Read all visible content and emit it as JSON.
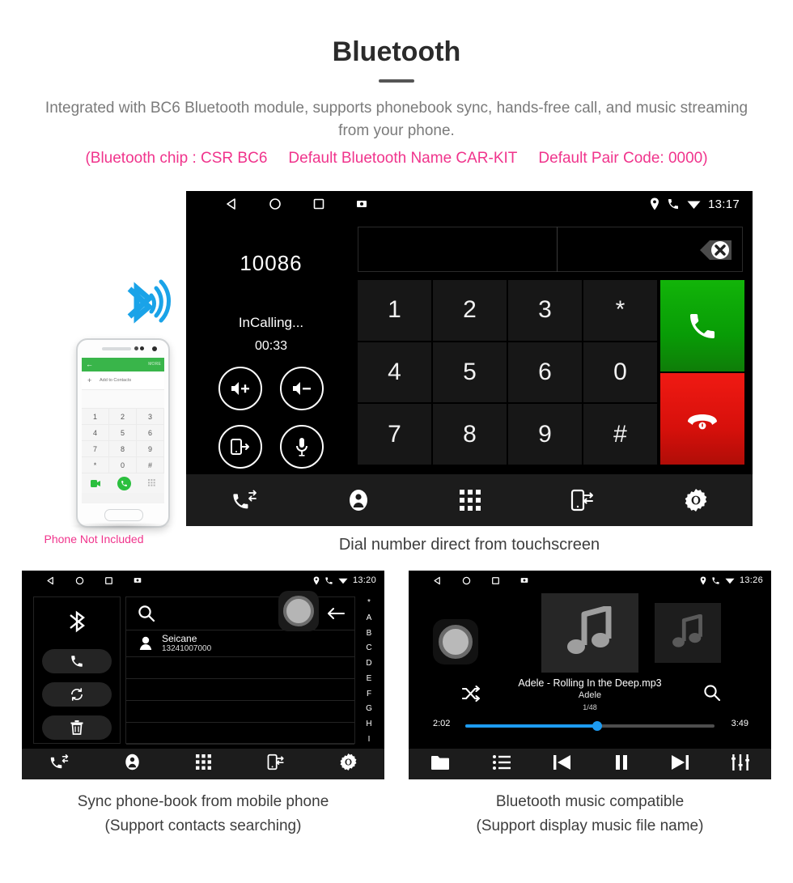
{
  "header": {
    "title": "Bluetooth",
    "subtitle": "Integrated with BC6 Bluetooth module, supports phonebook sync, hands-free call, and music streaming from your phone.",
    "spec_chip": "(Bluetooth chip : CSR BC6",
    "spec_name": "Default Bluetooth Name CAR-KIT",
    "spec_pair": "Default Pair Code: 0000)"
  },
  "phone_mockup": {
    "note": "Phone Not Included",
    "back_arrow": "←",
    "more_label": "MORE",
    "plus": "+",
    "add_to_contacts": "Add to Contacts",
    "keys": [
      "1",
      "2",
      "3",
      "4",
      "5",
      "6",
      "7",
      "8",
      "9",
      "*",
      "0",
      "#"
    ]
  },
  "dialer": {
    "caption": "Dial number direct from touchscreen",
    "statusbar": {
      "time": "13:17",
      "nav": [
        "back-icon",
        "home-icon",
        "recents-icon",
        "screenshot-icon"
      ],
      "status": [
        "location-icon",
        "phone-icon",
        "wifi-icon"
      ]
    },
    "dialed_number": "10086",
    "call_state": "InCalling...",
    "call_timer": "00:33",
    "round_buttons": [
      "volume-up-icon",
      "volume-down-icon",
      "transfer-audio-icon",
      "microphone-icon"
    ],
    "input_value": "",
    "backspace": "backspace-icon",
    "keys": [
      "1",
      "2",
      "3",
      "*",
      "4",
      "5",
      "6",
      "0",
      "7",
      "8",
      "9",
      "#"
    ],
    "call_button": "call-answer-icon",
    "hangup_button": "call-end-icon",
    "bottom_nav": [
      "call-log-icon",
      "contacts-icon",
      "keypad-icon",
      "phone-sync-icon",
      "settings-icon"
    ]
  },
  "phonebook": {
    "caption_line1": "Sync phone-book from mobile phone",
    "caption_line2": "(Support contacts searching)",
    "statusbar": {
      "time": "13:20"
    },
    "sidebar": [
      "bluetooth-icon",
      "call-icon",
      "sync-icon",
      "delete-icon"
    ],
    "search_placeholder": "",
    "contact": {
      "name": "Seicane",
      "number": "13241007000"
    },
    "alpha_index": [
      "*",
      "A",
      "B",
      "C",
      "D",
      "E",
      "F",
      "G",
      "H",
      "I"
    ],
    "bottom_nav": [
      "call-log-icon",
      "contacts-icon",
      "keypad-icon",
      "phone-sync-icon",
      "settings-icon"
    ]
  },
  "music": {
    "caption_line1": "Bluetooth music compatible",
    "caption_line2": "(Support display music file name)",
    "statusbar": {
      "time": "13:26"
    },
    "track_title": "Adele - Rolling In the Deep.mp3",
    "artist": "Adele",
    "track_count": "1/48",
    "current_time": "2:02",
    "duration": "3:49",
    "progress_percent": 53,
    "bottom_nav": [
      "folder-icon",
      "playlist-icon",
      "previous-icon",
      "pause-icon",
      "next-icon",
      "equalizer-icon"
    ]
  },
  "colors": {
    "accent_pink": "#f0348c",
    "call_green": "#12b409",
    "hangup_red": "#f01a13",
    "progress_blue": "#1d9bf0"
  }
}
